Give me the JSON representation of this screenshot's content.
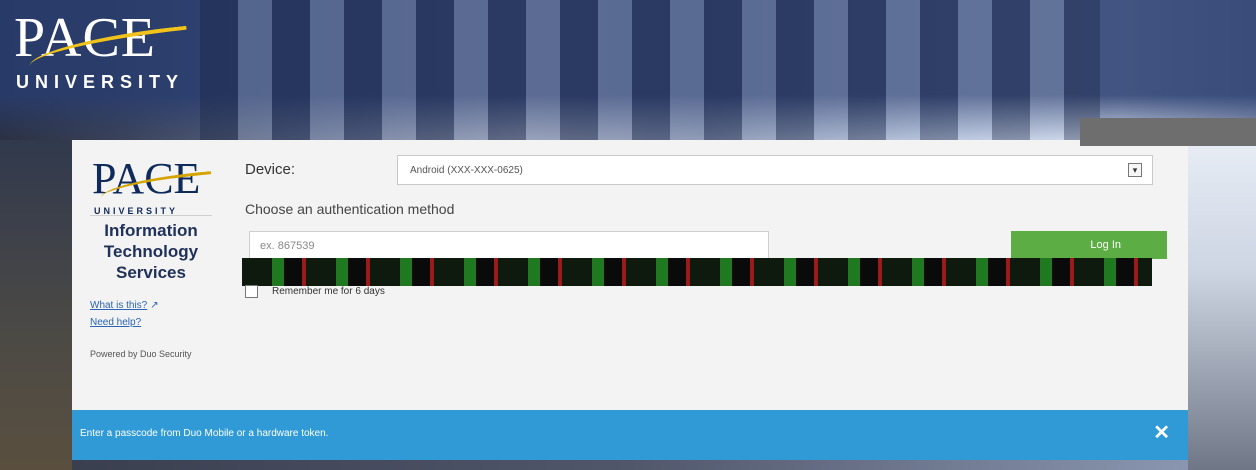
{
  "header": {
    "logo_word": "PACE",
    "logo_sub": "UNIVERSITY"
  },
  "card": {
    "logo_word": "PACE",
    "logo_sub": "UNIVERSITY",
    "its_lines": [
      "Information",
      "Technology",
      "Services"
    ],
    "links": [
      {
        "label": "What is this?",
        "icon": "external-link-icon"
      },
      {
        "label": "Need help?"
      }
    ],
    "powered_by": "Powered by Duo Security"
  },
  "form": {
    "device_label": "Device:",
    "device_value": "Android (XXX-XXX-0625)",
    "choose_label": "Choose an authentication method",
    "passcode_placeholder": "ex. 867539",
    "login_label": "Log In",
    "remember_label": "Remember me for 6 days"
  },
  "info_bar": {
    "message": "Enter a passcode from Duo Mobile or a hardware token.",
    "close_symbol": "✕"
  },
  "colors": {
    "accent_green": "#5bad44",
    "info_blue": "#2f9ad6",
    "brand_navy": "#0f2b5b",
    "brand_gold": "#d6a400"
  }
}
